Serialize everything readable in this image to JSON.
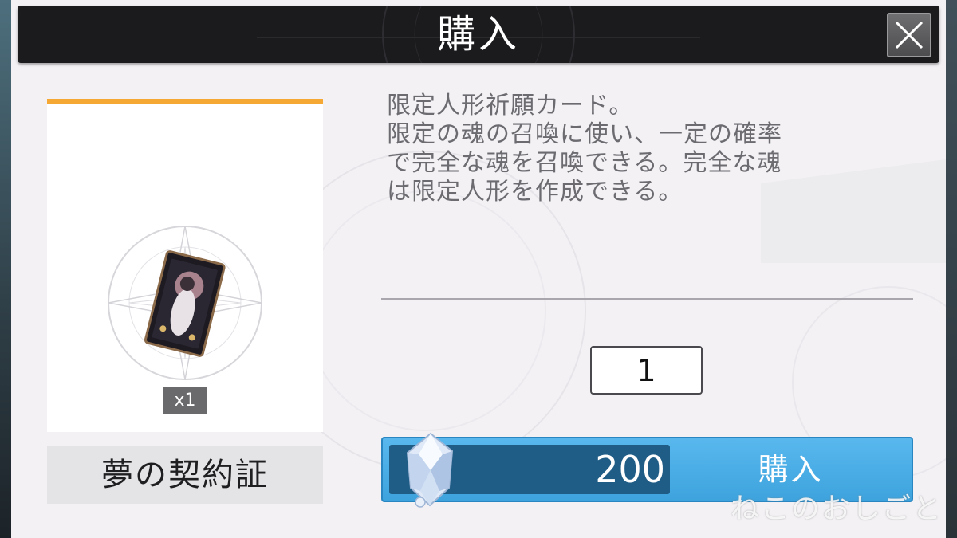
{
  "dialog": {
    "title": "購入",
    "close_icon": "close-icon"
  },
  "item": {
    "name": "夢の契約証",
    "quantity_badge": "x1",
    "icon": "tarot-card-icon",
    "accent_color": "#f5a833"
  },
  "description": {
    "lines": [
      "限定人形祈願カード。",
      "限定の魂の召喚に使い、一定の確率",
      "で完全な魂を召喚できる。完全な魂",
      "は限定人形を作成できる。"
    ]
  },
  "purchase": {
    "quantity_value": "1",
    "price": "200",
    "currency_icon": "crystal-gem-icon",
    "buy_label": "購入",
    "button_color": "#3ea3dd"
  },
  "watermark": "ねこのおしごと"
}
